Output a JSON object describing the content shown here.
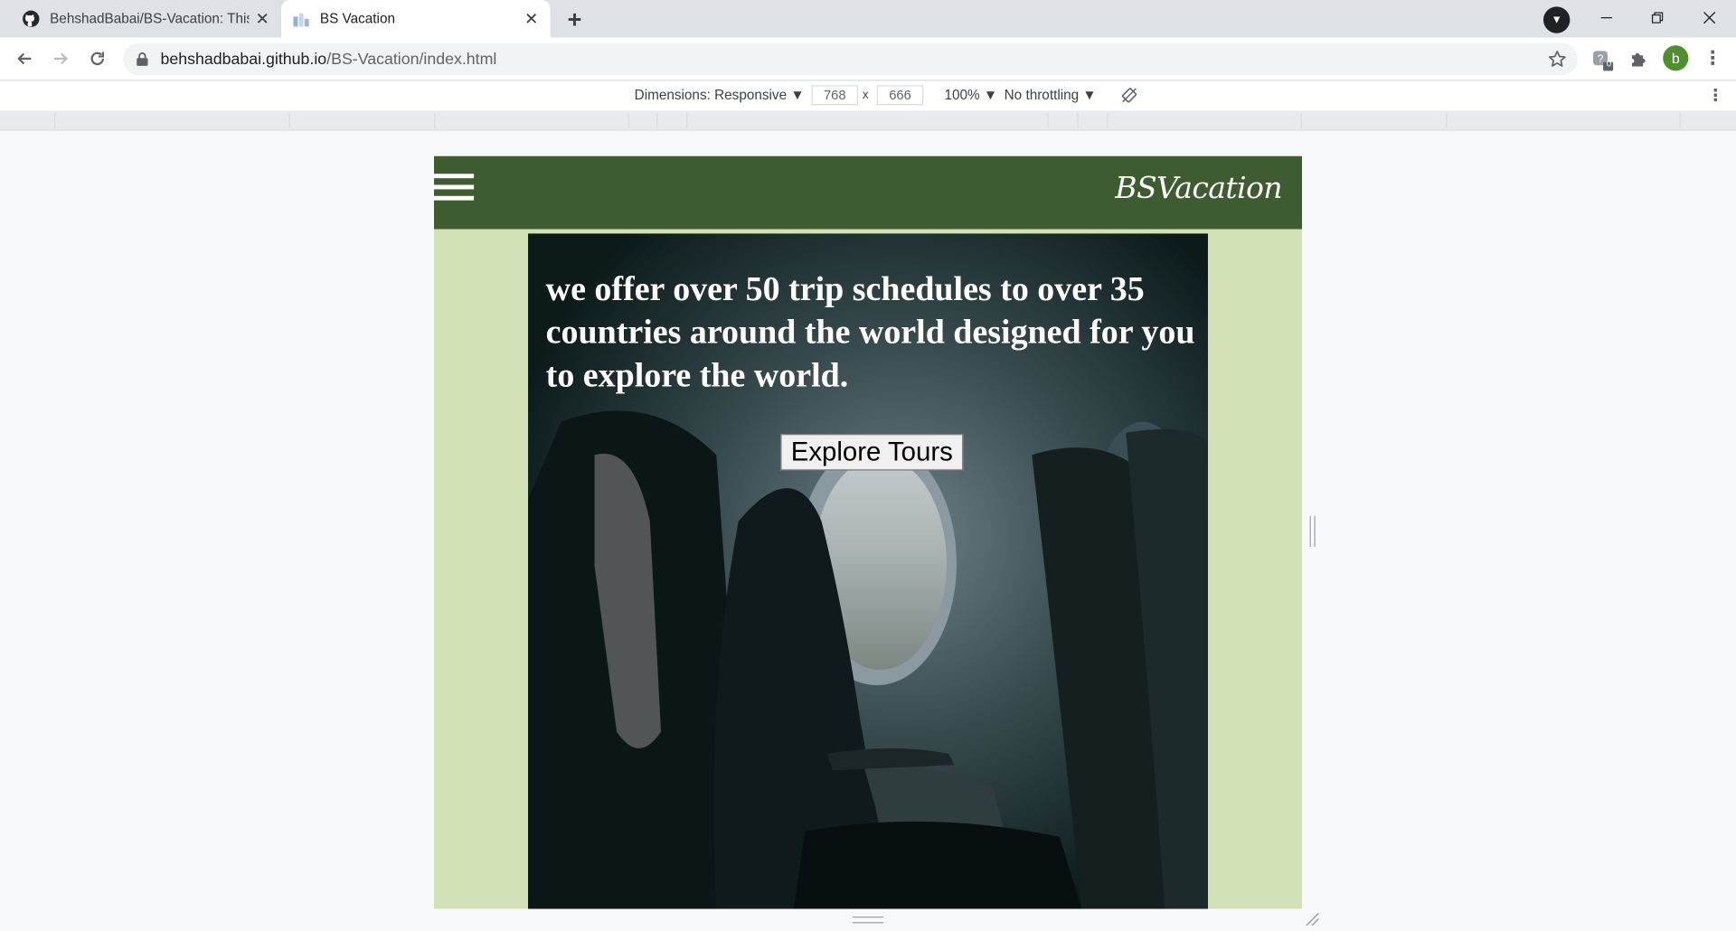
{
  "browser": {
    "tabs": [
      {
        "title": "BehshadBabai/BS-Vacation: This",
        "active": false,
        "favicon": "github-icon"
      },
      {
        "title": "BS Vacation",
        "active": true,
        "favicon": "site-icon"
      }
    ],
    "new_tab_label": "+",
    "url_host": "behshadbabai.github.io",
    "url_path": "/BS-Vacation/index.html",
    "extension_badge": "0",
    "avatar_letter": "b"
  },
  "devtools": {
    "dimensions_label": "Dimensions: Responsive ▼",
    "width": "768",
    "times": "x",
    "height": "666",
    "zoom": "100% ▼",
    "throttling": "No throttling ▼"
  },
  "site": {
    "brand": "BSVacation",
    "hero_text": "we offer over 50 trip schedules to over 35 countries around the world designed for you to explore the world.",
    "cta_label": "Explore Tours",
    "colors": {
      "header": "#3d5c2f",
      "page_bg": "#d3e2b6"
    }
  }
}
